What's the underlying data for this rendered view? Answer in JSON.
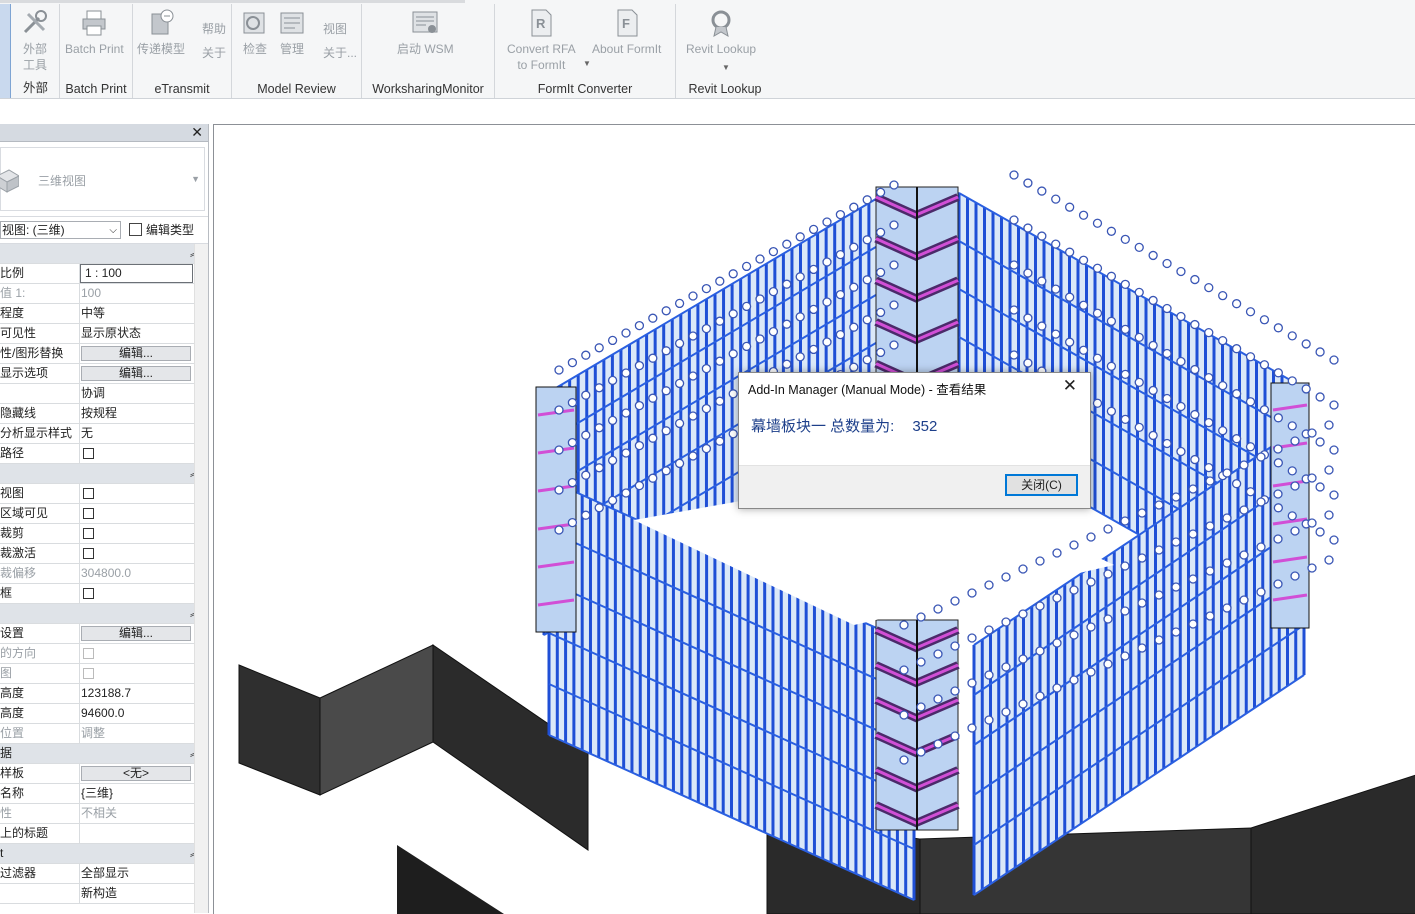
{
  "ribbon": {
    "panels": [
      {
        "title": "外部",
        "buttons": [
          {
            "label": "外部\n工具"
          }
        ]
      },
      {
        "title": "Batch Print",
        "buttons": [
          {
            "label": "Batch Print"
          }
        ]
      },
      {
        "title": "eTransmit",
        "buttons": [
          {
            "label": "传递模型"
          }
        ]
      },
      {
        "title": "Model Review",
        "buttons": [
          {
            "label": "检查"
          },
          {
            "label": "管理"
          }
        ],
        "side_top": "帮助",
        "side_bottom": "关于",
        "side2_top": "视图",
        "side2_bottom": "关于..."
      },
      {
        "title": "WorksharingMonitor",
        "buttons": [
          {
            "label": "启动 WSM"
          }
        ]
      },
      {
        "title": "FormIt Converter",
        "buttons": [
          {
            "label1": "Convert RFA",
            "label2": "to FormIt"
          },
          {
            "label": "About FormIt"
          }
        ]
      },
      {
        "title": "Revit Lookup",
        "buttons": [
          {
            "label": "Revit Lookup"
          }
        ]
      }
    ]
  },
  "properties": {
    "close_glyph": "✕",
    "type_name": "三维视图",
    "view_selector": "视图: (三维)",
    "edit_type": "编辑类型",
    "rows": [
      {
        "kind": "sec",
        "label": ""
      },
      {
        "kind": "input",
        "label": "比例",
        "value": "1 : 100"
      },
      {
        "kind": "text",
        "label": "值 1:",
        "value": "100",
        "disabled": true
      },
      {
        "kind": "text",
        "label": "程度",
        "value": "中等"
      },
      {
        "kind": "text",
        "label": "可见性",
        "value": "显示原状态"
      },
      {
        "kind": "button",
        "label": "性/图形替换",
        "value": "编辑..."
      },
      {
        "kind": "button",
        "label": "显示选项",
        "value": "编辑..."
      },
      {
        "kind": "text",
        "label": "",
        "value": "协调"
      },
      {
        "kind": "text",
        "label": "隐藏线",
        "value": "按规程"
      },
      {
        "kind": "text",
        "label": "分析显示样式",
        "value": "无"
      },
      {
        "kind": "check",
        "label": "路径"
      },
      {
        "kind": "sec",
        "label": ""
      },
      {
        "kind": "check",
        "label": "视图"
      },
      {
        "kind": "check",
        "label": "区域可见"
      },
      {
        "kind": "check",
        "label": "裁剪"
      },
      {
        "kind": "check",
        "label": "裁激活"
      },
      {
        "kind": "text",
        "label": "裁偏移",
        "value": "304800.0",
        "disabled": true
      },
      {
        "kind": "check",
        "label": "框"
      },
      {
        "kind": "sec",
        "label": ""
      },
      {
        "kind": "button",
        "label": "设置",
        "value": "编辑..."
      },
      {
        "kind": "check",
        "label": "的方向",
        "disabled": true
      },
      {
        "kind": "check",
        "label": "图",
        "disabled": true
      },
      {
        "kind": "text",
        "label": "高度",
        "value": "123188.7"
      },
      {
        "kind": "text",
        "label": "高度",
        "value": "94600.0"
      },
      {
        "kind": "text",
        "label": "位置",
        "value": "调整",
        "disabled": true
      },
      {
        "kind": "sec",
        "label": "据"
      },
      {
        "kind": "button",
        "label": "样板",
        "value": "<无>"
      },
      {
        "kind": "text",
        "label": "名称",
        "value": "{三维}"
      },
      {
        "kind": "text",
        "label": "性",
        "value": "不相关",
        "disabled": true
      },
      {
        "kind": "text",
        "label": "上的标题",
        "value": ""
      },
      {
        "kind": "sec",
        "label": "t"
      },
      {
        "kind": "text",
        "label": "过滤器",
        "value": "全部显示"
      },
      {
        "kind": "text",
        "label": "",
        "value": "新构造"
      }
    ]
  },
  "dialog": {
    "title": "Add-In Manager (Manual Mode) - 查看结果",
    "message": "幕墙板块一 总数量为:",
    "count": "352",
    "close_label": "关闭(C)"
  },
  "colors": {
    "curtain_blue": "#1f4fd6",
    "panel_fill": "#bcd3f2",
    "magenta": "#d14fd6",
    "dark_gray": "#3a3a3a"
  }
}
